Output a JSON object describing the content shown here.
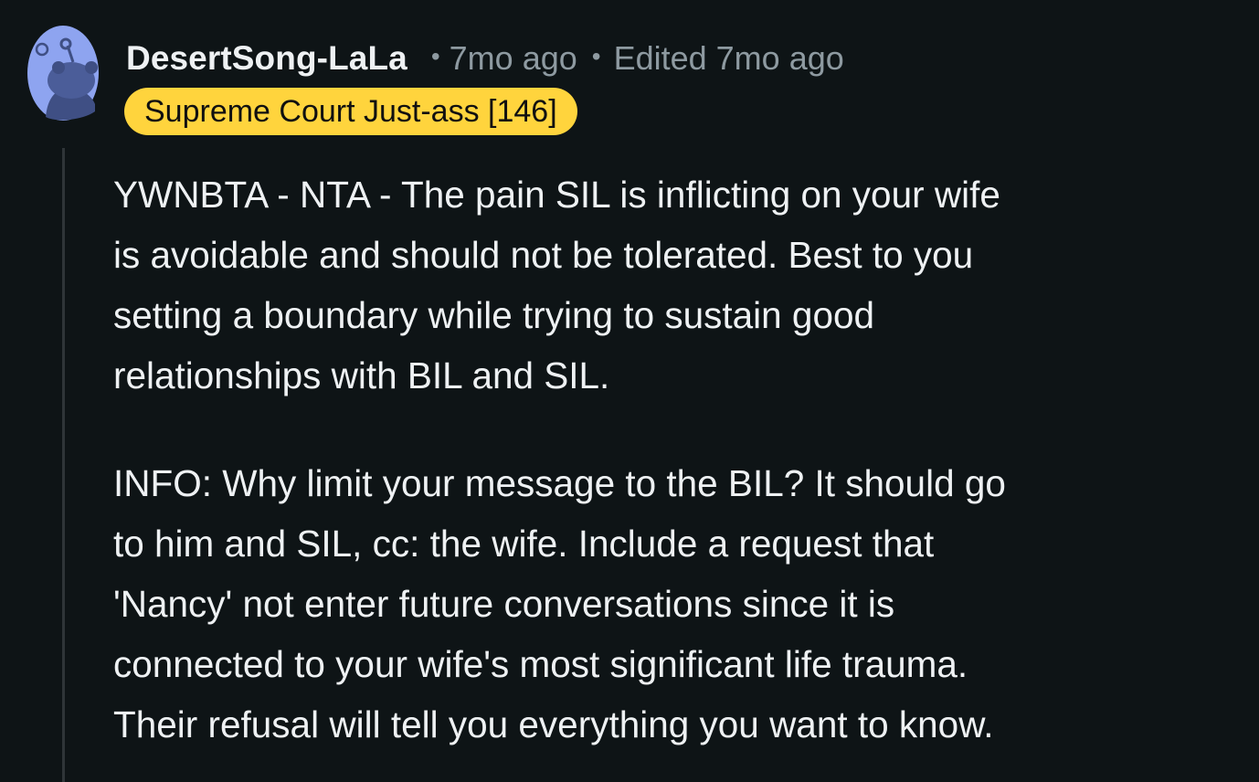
{
  "comment": {
    "author": "DesertSong-LaLa",
    "separator": "•",
    "posted": "7mo ago",
    "edited": "Edited 7mo ago",
    "flair": "Supreme Court Just-ass [146]",
    "paragraphs": [
      {
        "lines": [
          "YWNBTA - NTA - The pain SIL is inflicting on your wife",
          "is avoidable and should not be tolerated. Best to you",
          "setting a boundary while trying to sustain good",
          "relationships with BIL and SIL."
        ]
      },
      {
        "lines": [
          "INFO: Why limit your message to the BIL? It should go",
          "to him and SIL, cc: the wife. Include a request that",
          "'Nancy' not enter future conversations since it is",
          "connected to your wife's most significant life trauma.",
          "Their refusal will tell you everything you want to know."
        ]
      }
    ]
  },
  "colors": {
    "background": "#0e1416",
    "flair_background": "#ffd43d",
    "avatar_background": "#8ea4f0",
    "meta_text": "#8e9aa1"
  },
  "icons": {
    "avatar": "reddit-snoo-avatar-icon"
  }
}
